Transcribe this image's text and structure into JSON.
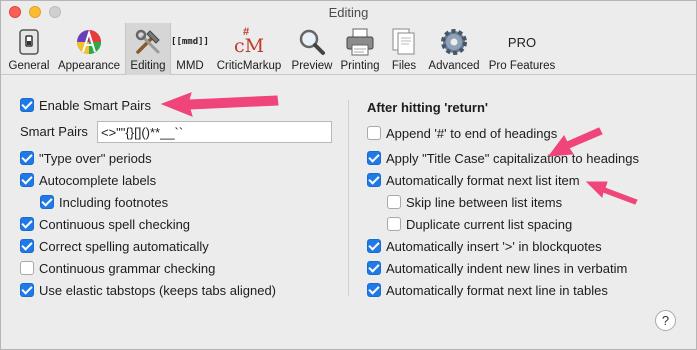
{
  "window": {
    "title": "Editing",
    "accent_color": "#1f7ae8",
    "annotation_color": "#f0457b"
  },
  "toolbar": {
    "items": [
      {
        "label": "General",
        "icon": "switch-icon"
      },
      {
        "label": "Appearance",
        "icon": "color-pen-icon"
      },
      {
        "label": "Editing",
        "icon": "tools-icon",
        "active": true
      },
      {
        "label": "MMD",
        "icon": "mmd-icon",
        "icon_text": "[[mmd]]"
      },
      {
        "label": "CriticMarkup",
        "icon": "criticmarkup-icon",
        "icon_text": "cM"
      },
      {
        "label": "Preview",
        "icon": "magnifier-icon"
      },
      {
        "label": "Printing",
        "icon": "printer-icon"
      },
      {
        "label": "Files",
        "icon": "files-icon"
      },
      {
        "label": "Advanced",
        "icon": "gear-icon"
      },
      {
        "label": "Pro Features",
        "icon": "pro-icon",
        "icon_text": "PRO"
      }
    ]
  },
  "left": {
    "enable_smart_pairs": {
      "label": "Enable Smart Pairs",
      "checked": true
    },
    "smart_pairs": {
      "label": "Smart Pairs",
      "value": "<>\"\"{}[]()**__``"
    },
    "options": [
      {
        "label": "\"Type over\" periods",
        "checked": true
      },
      {
        "label": "Autocomplete labels",
        "checked": true
      },
      {
        "label": "Including footnotes",
        "checked": true
      },
      {
        "label": "Continuous spell checking",
        "checked": true
      },
      {
        "label": "Correct spelling automatically",
        "checked": true
      },
      {
        "label": "Continuous grammar checking",
        "checked": false
      },
      {
        "label": "Use elastic tabstops (keeps tabs aligned)",
        "checked": true
      }
    ]
  },
  "right": {
    "heading": "After hitting 'return'",
    "options": [
      {
        "label": "Append '#' to end of headings",
        "checked": false
      },
      {
        "label": "Apply \"Title Case\" capitalization to headings",
        "checked": true
      },
      {
        "label": "Automatically format next list item",
        "checked": true
      },
      {
        "label": "Skip line between list items",
        "checked": false
      },
      {
        "label": "Duplicate current list spacing",
        "checked": false
      },
      {
        "label": "Automatically insert '>' in blockquotes",
        "checked": true
      },
      {
        "label": "Automatically indent new lines in verbatim",
        "checked": true
      },
      {
        "label": "Automatically format next line in tables",
        "checked": true
      }
    ]
  },
  "help": {
    "label": "?"
  }
}
